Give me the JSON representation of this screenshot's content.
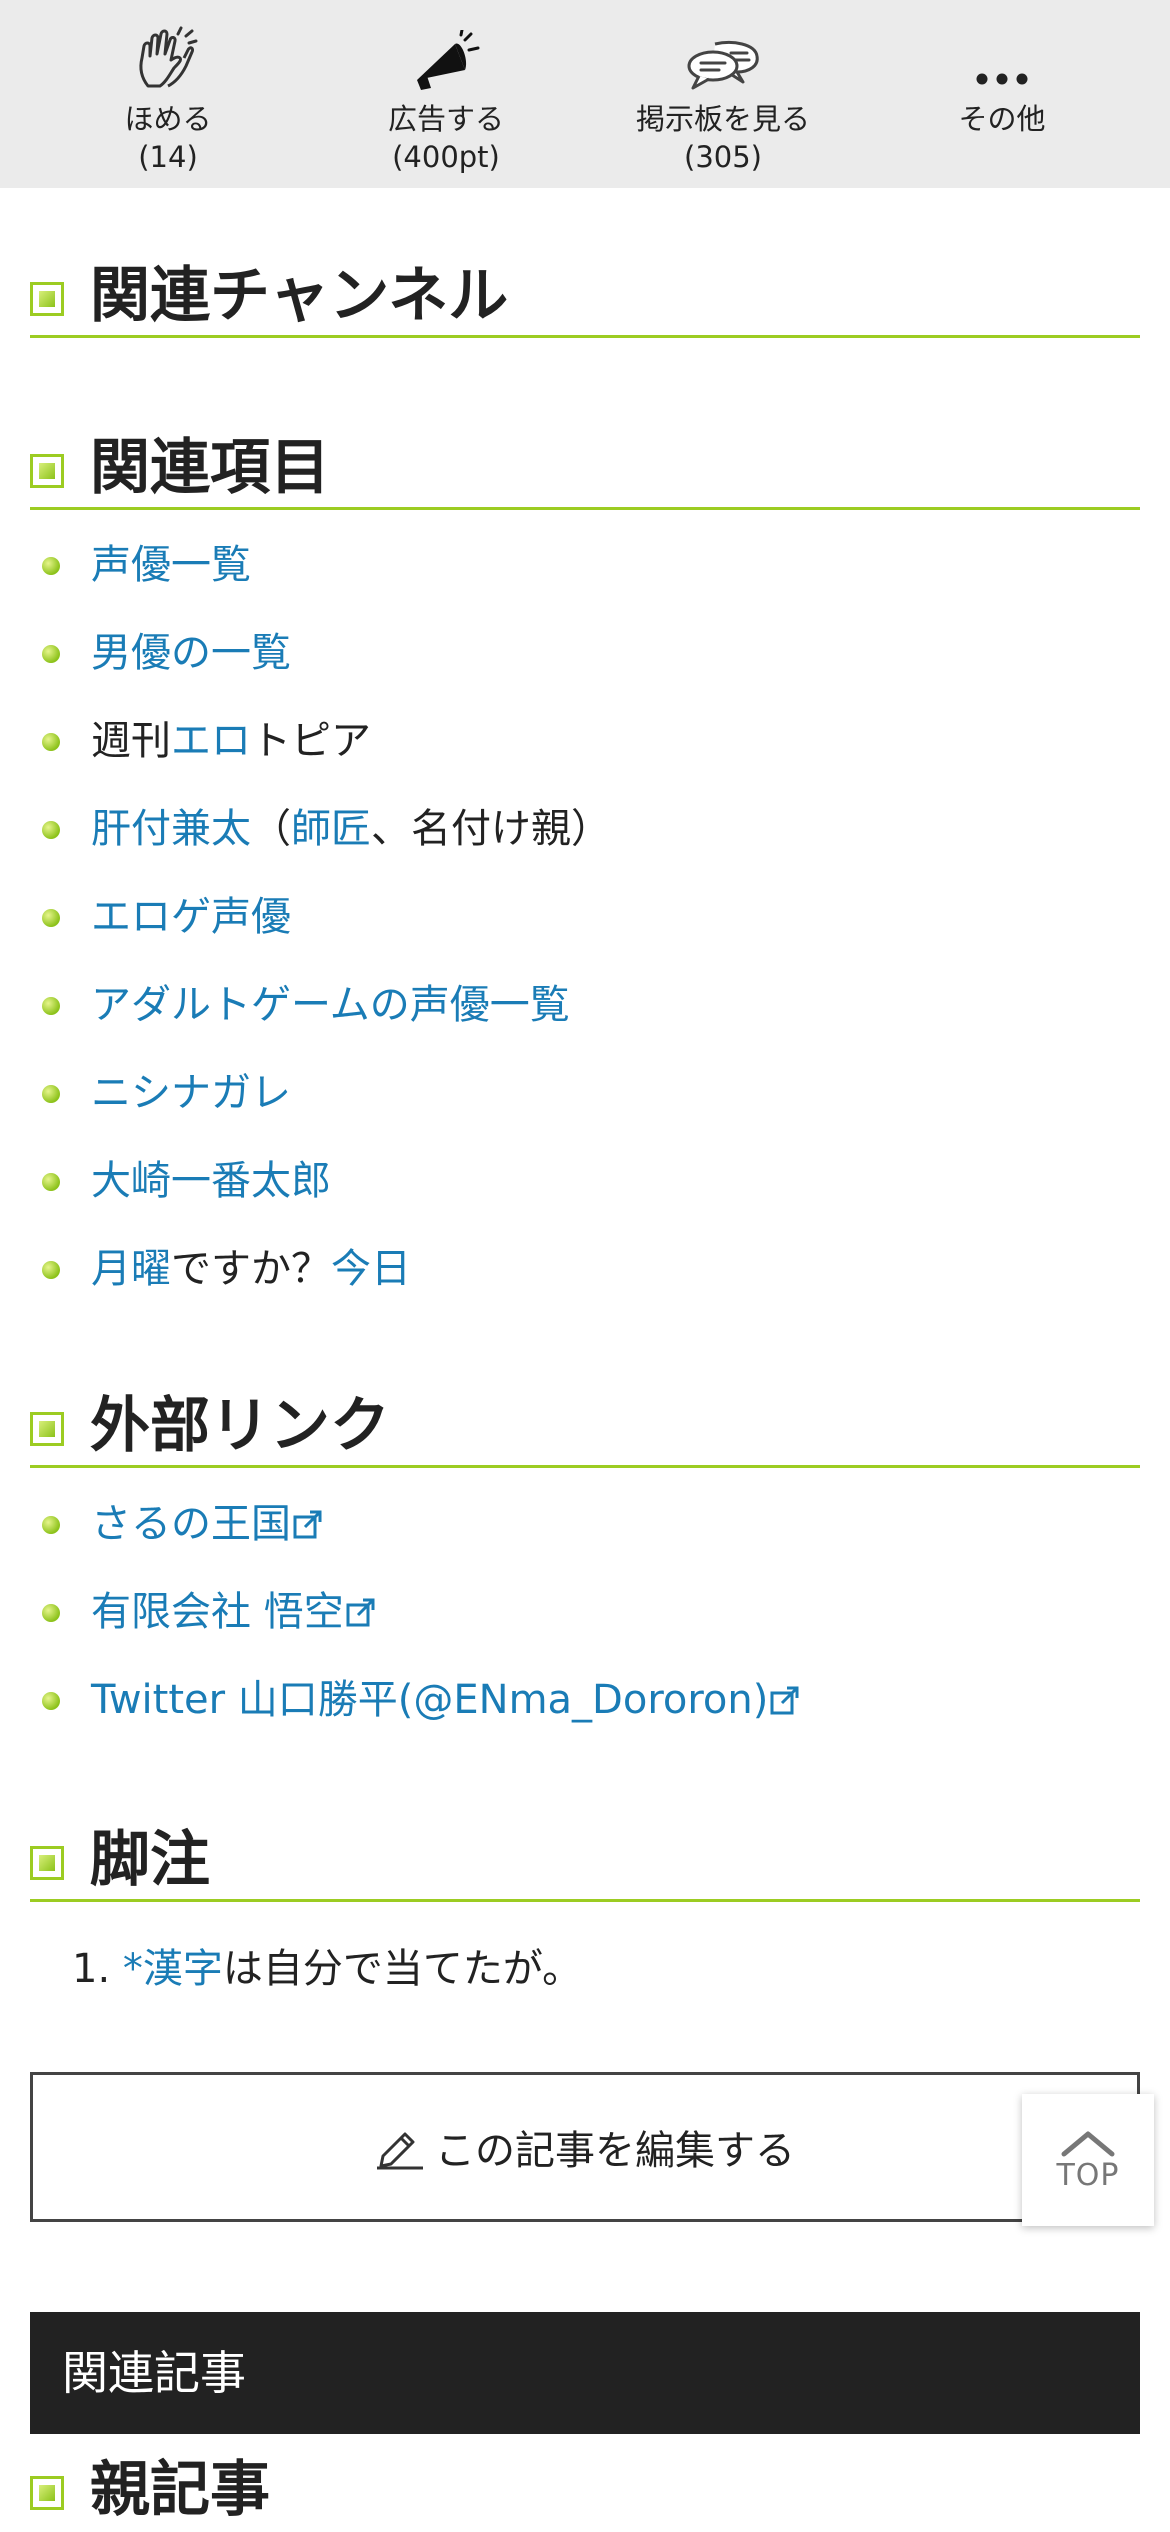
{
  "action_bar": {
    "items": [
      {
        "icon": "clap-hands-icon",
        "label": "ほめる",
        "count": "(14)"
      },
      {
        "icon": "megaphone-icon",
        "label": "広告する",
        "count": "(400pt)"
      },
      {
        "icon": "speech-bubbles-icon",
        "label": "掲示板を見る",
        "count": "(305)"
      },
      {
        "icon": "more-dots-icon",
        "label": "その他",
        "count": ""
      }
    ]
  },
  "sections": {
    "related_channels": {
      "title": "関連チャンネル"
    },
    "related_items": {
      "title": "関連項目",
      "items": [
        {
          "parts": [
            {
              "text": "声優一覧",
              "link": true
            }
          ]
        },
        {
          "parts": [
            {
              "text": "男優の一覧",
              "link": true
            }
          ]
        },
        {
          "parts": [
            {
              "text": "週刊",
              "link": false
            },
            {
              "text": "エロ",
              "link": true
            },
            {
              "text": "トピア",
              "link": false
            }
          ]
        },
        {
          "parts": [
            {
              "text": "肝付兼太",
              "link": true
            },
            {
              "text": "（",
              "link": false
            },
            {
              "text": "師匠",
              "link": true
            },
            {
              "text": "、名付け親）",
              "link": false
            }
          ]
        },
        {
          "parts": [
            {
              "text": "エロゲ声優",
              "link": true
            }
          ]
        },
        {
          "parts": [
            {
              "text": "アダルトゲームの声優一覧",
              "link": true
            }
          ]
        },
        {
          "parts": [
            {
              "text": "ニシナガレ",
              "link": true
            }
          ]
        },
        {
          "parts": [
            {
              "text": "大崎一番太郎",
              "link": true
            }
          ]
        },
        {
          "parts": [
            {
              "text": "月曜",
              "link": true
            },
            {
              "text": "ですか？",
              "link": false
            },
            {
              "text": "今日",
              "link": true
            }
          ]
        }
      ]
    },
    "external_links": {
      "title": "外部リンク",
      "items": [
        {
          "text": "さるの王国"
        },
        {
          "text": "有限会社 悟空"
        },
        {
          "text": "Twitter 山口勝平(@ENma_Dororon)"
        }
      ]
    },
    "footnotes": {
      "title": "脚注",
      "items": [
        {
          "number": "1.",
          "marker": "*",
          "link_text": "漢字",
          "rest": "は自分で当てたが。"
        }
      ]
    }
  },
  "edit_button": {
    "label": "この記事を編集する",
    "icon": "pencil-icon"
  },
  "top_button": {
    "label": "TOP",
    "icon": "chevron-up-icon"
  },
  "related_articles": {
    "label": "関連記事"
  },
  "parent_article": {
    "title": "親記事"
  },
  "colors": {
    "accent": "#9ccc22",
    "link": "#1a7cb6",
    "bar": "#ebebeb",
    "dark": "#222222"
  }
}
